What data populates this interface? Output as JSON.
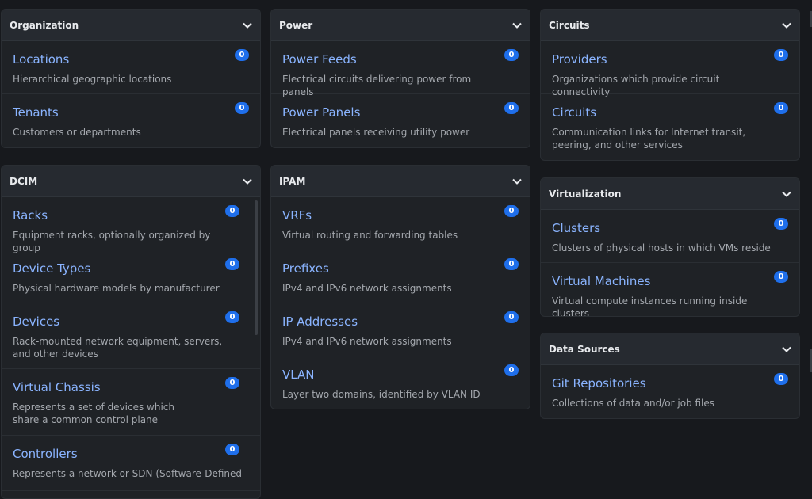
{
  "cards": {
    "organization": {
      "title": "Organization",
      "items": [
        {
          "title": "Locations",
          "desc": "Hierarchical geographic locations",
          "count": "0"
        },
        {
          "title": "Tenants",
          "desc": "Customers or departments",
          "count": "0"
        }
      ]
    },
    "power": {
      "title": "Power",
      "items": [
        {
          "title": "Power Feeds",
          "desc": "Electrical circuits delivering power from panels",
          "count": "0"
        },
        {
          "title": "Power Panels",
          "desc": "Electrical panels receiving utility power",
          "count": "0"
        }
      ]
    },
    "circuits": {
      "title": "Circuits",
      "items": [
        {
          "title": "Providers",
          "desc": "Organizations which provide circuit connectivity",
          "count": "0"
        },
        {
          "title": "Circuits",
          "desc": "Communication links for Internet transit, peering, and other services",
          "count": "0"
        }
      ]
    },
    "dcim": {
      "title": "DCIM",
      "items": [
        {
          "title": "Racks",
          "desc": "Equipment racks, optionally organized by group",
          "count": "0"
        },
        {
          "title": "Device Types",
          "desc": "Physical hardware models by manufacturer",
          "count": "0"
        },
        {
          "title": "Devices",
          "desc": "Rack-mounted network equipment, servers, and other devices",
          "count": "0"
        },
        {
          "title": "Virtual Chassis",
          "desc": "Represents a set of devices which share a common control plane",
          "count": "0"
        },
        {
          "title": "Controllers",
          "desc": "Represents a network or SDN (Software-Defined",
          "count": "0"
        }
      ]
    },
    "ipam": {
      "title": "IPAM",
      "items": [
        {
          "title": "VRFs",
          "desc": "Virtual routing and forwarding tables",
          "count": "0"
        },
        {
          "title": "Prefixes",
          "desc": "IPv4 and IPv6 network assignments",
          "count": "0"
        },
        {
          "title": "IP Addresses",
          "desc": "IPv4 and IPv6 network assignments",
          "count": "0"
        },
        {
          "title": "VLAN",
          "desc": "Layer two domains, identified by VLAN ID",
          "count": "0"
        }
      ]
    },
    "virtualization": {
      "title": "Virtualization",
      "items": [
        {
          "title": "Clusters",
          "desc": "Clusters of physical hosts in which VMs reside",
          "count": "0"
        },
        {
          "title": "Virtual Machines",
          "desc": "Virtual compute instances running inside clusters",
          "count": "0"
        }
      ]
    },
    "data_sources": {
      "title": "Data Sources",
      "items": [
        {
          "title": "Git Repositories",
          "desc": "Collections of data and/or job files",
          "count": "0"
        }
      ]
    }
  },
  "icons": {
    "collapse": "chevron-down-icon"
  },
  "colors": {
    "link": "#8ab4ff",
    "badge": "#1f6feb",
    "background": "#17191d",
    "card": "#1f2226",
    "header": "#262a30"
  }
}
